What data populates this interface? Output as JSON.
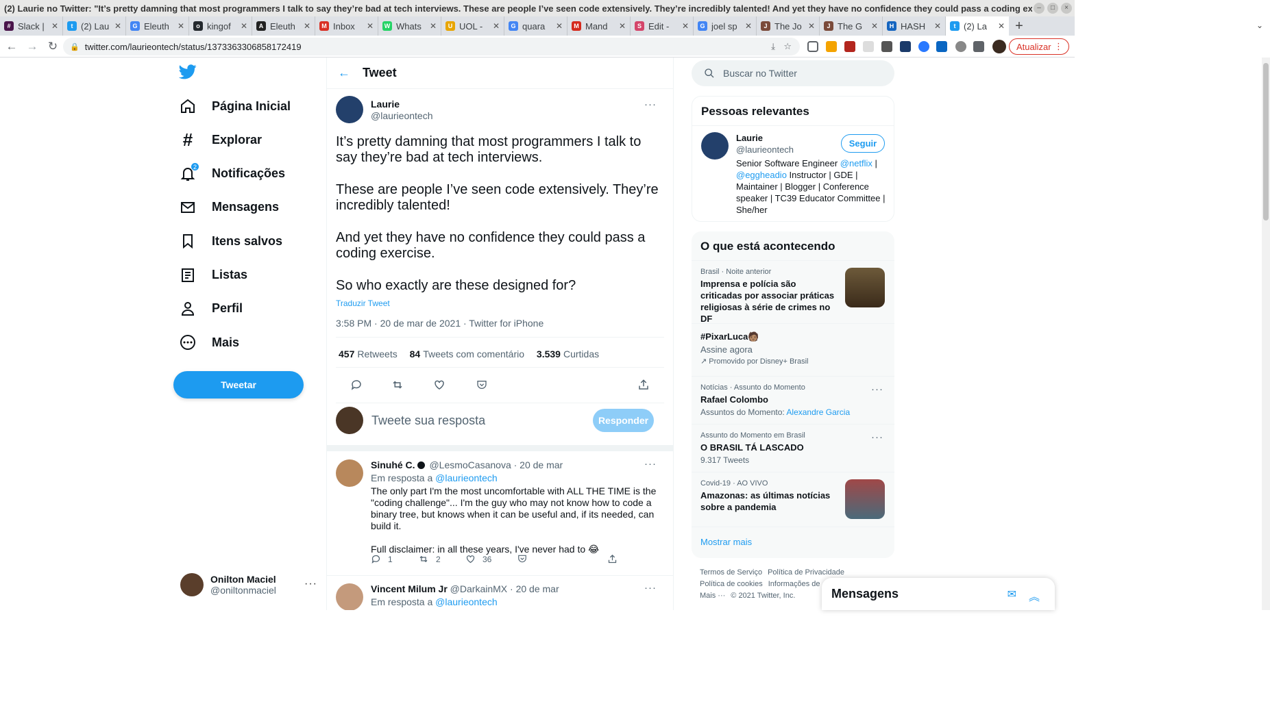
{
  "window": {
    "title": "(2) Laurie no Twitter: \"It’s pretty damning that most programmers I talk to say they’re bad at tech interviews. These are people I’ve seen code extensively. They’re incredibly talented! And yet they have no confidence they could pass a coding exerc..."
  },
  "tabs": [
    {
      "label": "Slack |",
      "color": "#4a154b",
      "glyph": "#"
    },
    {
      "label": "(2) Lau",
      "color": "#1d9bf0",
      "glyph": "t"
    },
    {
      "label": "Eleuth",
      "color": "#4285f4",
      "glyph": "G"
    },
    {
      "label": "kingof",
      "color": "#24292e",
      "glyph": "o"
    },
    {
      "label": "Eleuth",
      "color": "#222",
      "glyph": "A"
    },
    {
      "label": "Inbox",
      "color": "#d93025",
      "glyph": "M"
    },
    {
      "label": "Whats",
      "color": "#25d366",
      "glyph": "W"
    },
    {
      "label": "UOL -",
      "color": "#e8a500",
      "glyph": "U"
    },
    {
      "label": "quara",
      "color": "#4285f4",
      "glyph": "G"
    },
    {
      "label": "Mand",
      "color": "#d52b1e",
      "glyph": "M"
    },
    {
      "label": "Edit -",
      "color": "#d4456a",
      "glyph": "S"
    },
    {
      "label": "joel sp",
      "color": "#4285f4",
      "glyph": "G"
    },
    {
      "label": "The Jo",
      "color": "#7a4a3a",
      "glyph": "J"
    },
    {
      "label": "The G",
      "color": "#7a4a3a",
      "glyph": "J"
    },
    {
      "label": "HASH",
      "color": "#1565c0",
      "glyph": "H"
    },
    {
      "label": "(2) La",
      "color": "#1d9bf0",
      "glyph": "t"
    }
  ],
  "address": {
    "url": "twitter.com/laurieontech/status/1373363306858172419",
    "update_label": "Atualizar"
  },
  "sidebar": {
    "items": [
      {
        "label": "Página Inicial",
        "icon": "home-icon"
      },
      {
        "label": "Explorar",
        "icon": "hashtag-icon"
      },
      {
        "label": "Notificações",
        "icon": "bell-icon",
        "badge": "2"
      },
      {
        "label": "Mensagens",
        "icon": "mail-icon"
      },
      {
        "label": "Itens salvos",
        "icon": "bookmark-icon"
      },
      {
        "label": "Listas",
        "icon": "list-icon"
      },
      {
        "label": "Perfil",
        "icon": "person-icon"
      },
      {
        "label": "Mais",
        "icon": "more-circle-icon"
      }
    ],
    "tweet_button": "Tweetar",
    "account": {
      "name": "Onilton Maciel",
      "handle": "@oniltonmaciel"
    }
  },
  "main": {
    "header": "Tweet",
    "tweet": {
      "name": "Laurie",
      "handle": "@laurieontech",
      "paragraphs": [
        "It’s pretty damning that most programmers I talk to say they’re bad at tech interviews.",
        "These are people I’ve seen code extensively. They’re incredibly talented!",
        "And yet they have no confidence they could pass a coding exercise.",
        "So who exactly are these designed for?"
      ],
      "translate": "Traduzir Tweet",
      "meta": "3:58 PM · 20 de mar de 2021 · Twitter for iPhone",
      "retweets_count": "457",
      "retweets_label": "Retweets",
      "quotes_count": "84",
      "quotes_label": "Tweets com comentário",
      "likes_count": "3.539",
      "likes_label": "Curtidas"
    },
    "reply_box": {
      "placeholder": "Tweete sua resposta",
      "button": "Responder"
    },
    "replies": [
      {
        "name": "Sinuhé C.",
        "handle": "@LesmoCasanova",
        "date": "· 20 de mar",
        "in_reply": "Em resposta a",
        "mention": "@laurieontech",
        "text1": "The only part I'm the most uncomfortable with ALL THE TIME is the \"coding challenge\"... I'm the guy who may not know how to code a binary tree, but knows when it can be useful and, if its needed, can build it.",
        "text2": "Full disclaimer: in all these years, I've never had to 😂",
        "reply_count": "1",
        "retweet_count": "2",
        "like_count": "36"
      },
      {
        "name": "Vincent Milum Jr",
        "handle": "@DarkainMX",
        "date": "· 20 de mar",
        "in_reply": "Em resposta a",
        "mention": "@laurieontech"
      }
    ]
  },
  "right": {
    "search_placeholder": "Buscar no Twitter",
    "relevant": {
      "title": "Pessoas relevantes",
      "name": "Laurie",
      "handle": "@laurieontech",
      "follow": "Seguir",
      "bio_a": "Senior Software Engineer ",
      "bio_l1": "@netflix",
      "bio_b": " | ",
      "bio_l2": "@eggheadio",
      "bio_c": " Instructor | GDE | Maintainer | Blogger | Conference speaker | TC39 Educator Committee | She/her"
    },
    "trends": {
      "title": "O que está acontecendo",
      "items": [
        {
          "meta": "Brasil · Noite anterior",
          "title": "Imprensa e polícia são criticadas por associar práticas religiosas à série de crimes no DF"
        },
        {
          "meta": "",
          "title": "#PixarLuca🧑🏽",
          "sub": "Assine agora",
          "promo": "Promovido por Disney+ Brasil"
        },
        {
          "meta": "Notícias · Assunto do Momento",
          "title": "Rafael Colombo",
          "sub": "Assuntos do Momento:",
          "sub_link": "Alexandre Garcia"
        },
        {
          "meta": "Assunto do Momento em Brasil",
          "title": "O BRASIL TÁ LASCADO",
          "sub": "9.317 Tweets"
        },
        {
          "meta": "Covid-19 · AO VIVO",
          "title": "Amazonas: as últimas notícias sobre a pandemia"
        }
      ],
      "show_more": "Mostrar mais"
    },
    "footer": {
      "terms": "Termos de Serviço",
      "privacy": "Política de Privacidade",
      "cookies": "Política de cookies",
      "ads": "Informações de",
      "more": "Mais ···",
      "copyright": "© 2021 Twitter, Inc."
    },
    "messages_dock": "Mensagens"
  }
}
